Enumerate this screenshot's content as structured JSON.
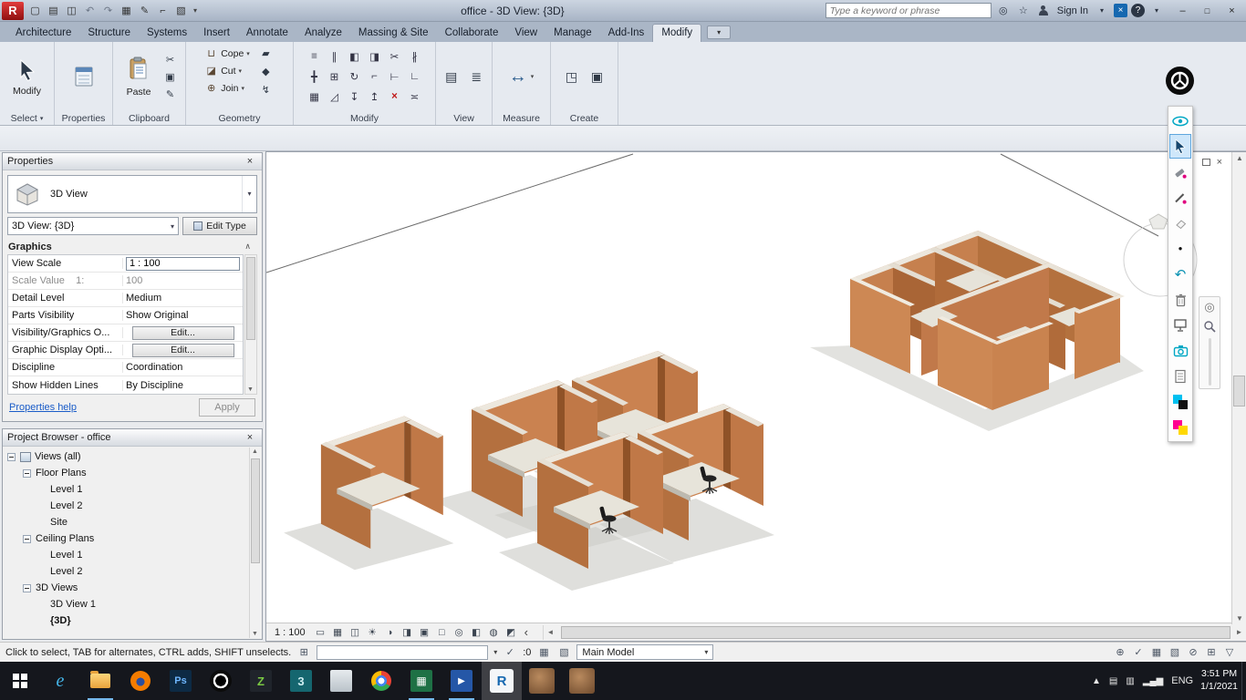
{
  "titlebar": {
    "title": "office - 3D View: {3D}",
    "search_placeholder": "Type a keyword or phrase",
    "sign_in": "Sign In",
    "app_letter": "R"
  },
  "tabs": {
    "items": [
      "Architecture",
      "Structure",
      "Systems",
      "Insert",
      "Annotate",
      "Analyze",
      "Massing & Site",
      "Collaborate",
      "View",
      "Manage",
      "Add-Ins",
      "Modify"
    ]
  },
  "ribbon": {
    "select": {
      "button": "Modify",
      "label": "Select"
    },
    "properties": {
      "label": "Properties"
    },
    "clipboard": {
      "button": "Paste",
      "label": "Clipboard"
    },
    "geometry": {
      "cope": "Cope",
      "cut": "Cut",
      "join": "Join",
      "label": "Geometry"
    },
    "modify": {
      "label": "Modify"
    },
    "view": {
      "label": "View"
    },
    "measure": {
      "label": "Measure"
    },
    "create": {
      "label": "Create"
    }
  },
  "properties": {
    "title": "Properties",
    "type_name": "3D View",
    "selector": "3D View: {3D}",
    "edit_type": "Edit Type",
    "section": "Graphics",
    "rows": [
      {
        "label": "View Scale",
        "value": "1 : 100"
      },
      {
        "label": "Scale Value    1:",
        "value": "100"
      },
      {
        "label": "Detail Level",
        "value": "Medium"
      },
      {
        "label": "Parts Visibility",
        "value": "Show Original"
      },
      {
        "label": "Visibility/Graphics O...",
        "value": "Edit..."
      },
      {
        "label": "Graphic Display Opti...",
        "value": "Edit..."
      },
      {
        "label": "Discipline",
        "value": "Coordination"
      },
      {
        "label": "Show Hidden Lines",
        "value": "By Discipline"
      }
    ],
    "help": "Properties help",
    "apply": "Apply"
  },
  "browser": {
    "title": "Project Browser - office",
    "items": [
      "Views (all)",
      "Floor Plans",
      "Level 1",
      "Level 2",
      "Site",
      "Ceiling Plans",
      "Level 1",
      "Level 2",
      "3D Views",
      "3D View 1",
      "{3D}"
    ]
  },
  "viewbar": {
    "scale": "1 : 100"
  },
  "statusbar": {
    "hint": "Click to select, TAB for alternates, CTRL adds, SHIFT unselects.",
    "count": ":0",
    "main_model": "Main Model"
  },
  "taskbar": {
    "ie": "e",
    "ps": "Ps",
    "z": "Z",
    "max": "3",
    "excel": "▦",
    "media": "▶",
    "revit": "R",
    "lang": "ENG",
    "time": "3:51 PM",
    "date": "1/1/2021"
  },
  "icons": {
    "qa": [
      "▢",
      "▤",
      "◫",
      "↶",
      "↷",
      "▦",
      "✎",
      "⌐",
      "▧"
    ],
    "caret": "▾",
    "binoculars": "◎",
    "star": "☆",
    "win_min": "–",
    "win_max": "□",
    "win_close": "×",
    "clip_small": [
      "✂",
      "▣",
      "✎"
    ],
    "geo_btn": [
      "⊔",
      "◪",
      "⊕"
    ],
    "geo_side": [
      "▰",
      "◆",
      "↯"
    ],
    "modify_grid": [
      "≡",
      "∥",
      "◧",
      "◨",
      "✂",
      "∦",
      "╋",
      "⊞",
      "↻",
      "⌐",
      "⊢",
      "∟",
      "▦",
      "◿",
      "↧",
      "↥",
      "×",
      "≍"
    ],
    "view_panel": [
      "▤",
      "≣"
    ],
    "measure": "↔",
    "create": [
      "◳",
      "▣"
    ],
    "collapse": "∧",
    "viewbar": [
      "▭",
      "▦",
      "◫",
      "☀",
      "◑",
      "◨",
      "▣",
      "□",
      "◎",
      "◧",
      "◍",
      "◩"
    ],
    "back": "‹",
    "status_right": [
      "⊞",
      "✓",
      "▦",
      "▧",
      "⊕",
      "⊘",
      "▽"
    ],
    "tray": [
      "▲",
      "▤",
      "▥",
      "▂▄▆"
    ],
    "dot": "●",
    "undo": "↶",
    "wheel": "◎"
  }
}
